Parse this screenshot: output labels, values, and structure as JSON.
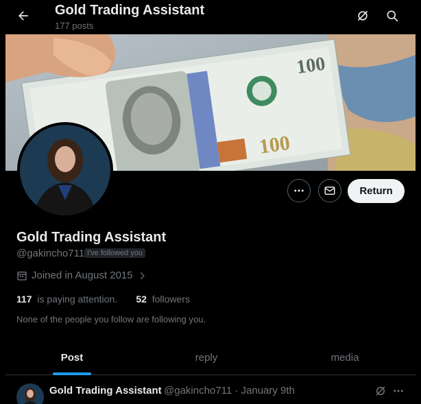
{
  "header": {
    "title": "Gold Trading Assistant",
    "posts_count": "177 posts"
  },
  "icons": {
    "back": "arrow-left-icon",
    "grok": "grok-icon",
    "search": "search-icon",
    "more": "more-icon",
    "message": "message-icon",
    "calendar": "calendar-icon",
    "chevron": "chevron-right-icon"
  },
  "banner": {
    "description": "hundred-dollar-bills-photo"
  },
  "profile": {
    "name": "Gold Trading Assistant",
    "handle": "@gakincho711",
    "follows_you_badge": "I've followed you",
    "joined": "Joined in August 2015",
    "following_count": "117",
    "following_label": "is paying attention.",
    "followers_count": "52",
    "followers_label": "followers",
    "mutual_note": "None of the people you follow are following you."
  },
  "actions": {
    "return_label": "Return"
  },
  "tabs": [
    {
      "label": "Post",
      "active": true
    },
    {
      "label": "reply",
      "active": false
    },
    {
      "label": "media",
      "active": false
    }
  ],
  "post": {
    "author": "Gold Trading Assistant",
    "meta": "@gakincho711 · January 9th",
    "text": ""
  },
  "colors": {
    "background": "#000000",
    "accent": "#1d9bf0",
    "text_primary": "#e7e9ea",
    "text_secondary": "#71767b",
    "return_bg": "#eff3f4"
  }
}
